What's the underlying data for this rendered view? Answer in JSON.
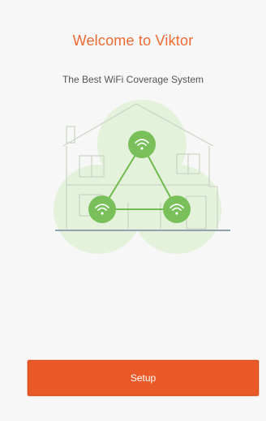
{
  "header": {
    "title": "Welcome to Viktor",
    "subtitle": "The Best WiFi Coverage System"
  },
  "illustration": {
    "nodes": [
      "wifi-icon",
      "wifi-icon",
      "wifi-icon"
    ]
  },
  "actions": {
    "setup_label": "Setup"
  },
  "colors": {
    "accent": "#ea5a28",
    "title": "#ee6a35",
    "node": "#7dc45b",
    "node_bg": "#e3f1da"
  }
}
